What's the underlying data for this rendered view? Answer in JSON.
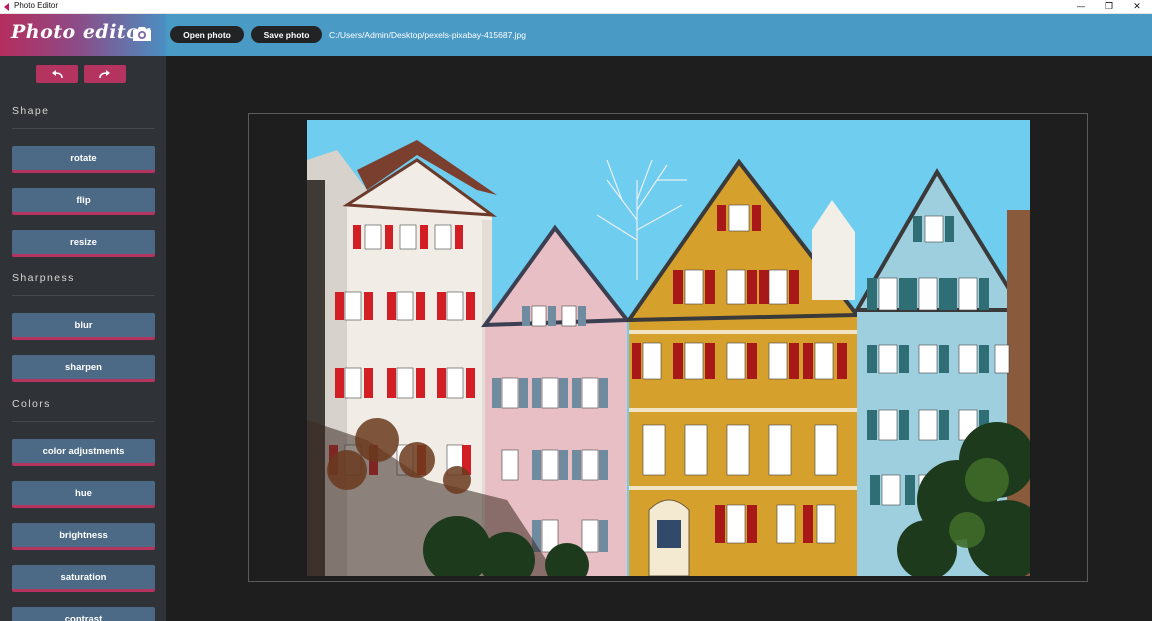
{
  "window": {
    "title": "Photo Editor",
    "minimize_glyph": "—",
    "maximize_glyph": "❐",
    "close_glyph": "✕"
  },
  "header": {
    "logo_text": "Photo editor",
    "open_label": "Open photo",
    "save_label": "Save photo",
    "file_path": "C:/Users/Admin/Desktop/pexels-pixabay-415687.jpg"
  },
  "history": {
    "undo_icon": "undo-icon",
    "redo_icon": "redo-icon"
  },
  "sidebar": {
    "sections": [
      {
        "label": "Shape",
        "buttons": [
          "rotate",
          "flip",
          "resize"
        ]
      },
      {
        "label": "Sharpness",
        "buttons": [
          "blur",
          "sharpen"
        ]
      },
      {
        "label": "Colors",
        "buttons": [
          "color adjustments",
          "hue",
          "brightness",
          "saturation",
          "contrast"
        ]
      }
    ]
  },
  "colors": {
    "header": "#4a9ac6",
    "accent": "#b5345f",
    "tool_button": "#4c6a86",
    "sidebar": "#2f3236",
    "canvas": "#1e1e1f"
  }
}
